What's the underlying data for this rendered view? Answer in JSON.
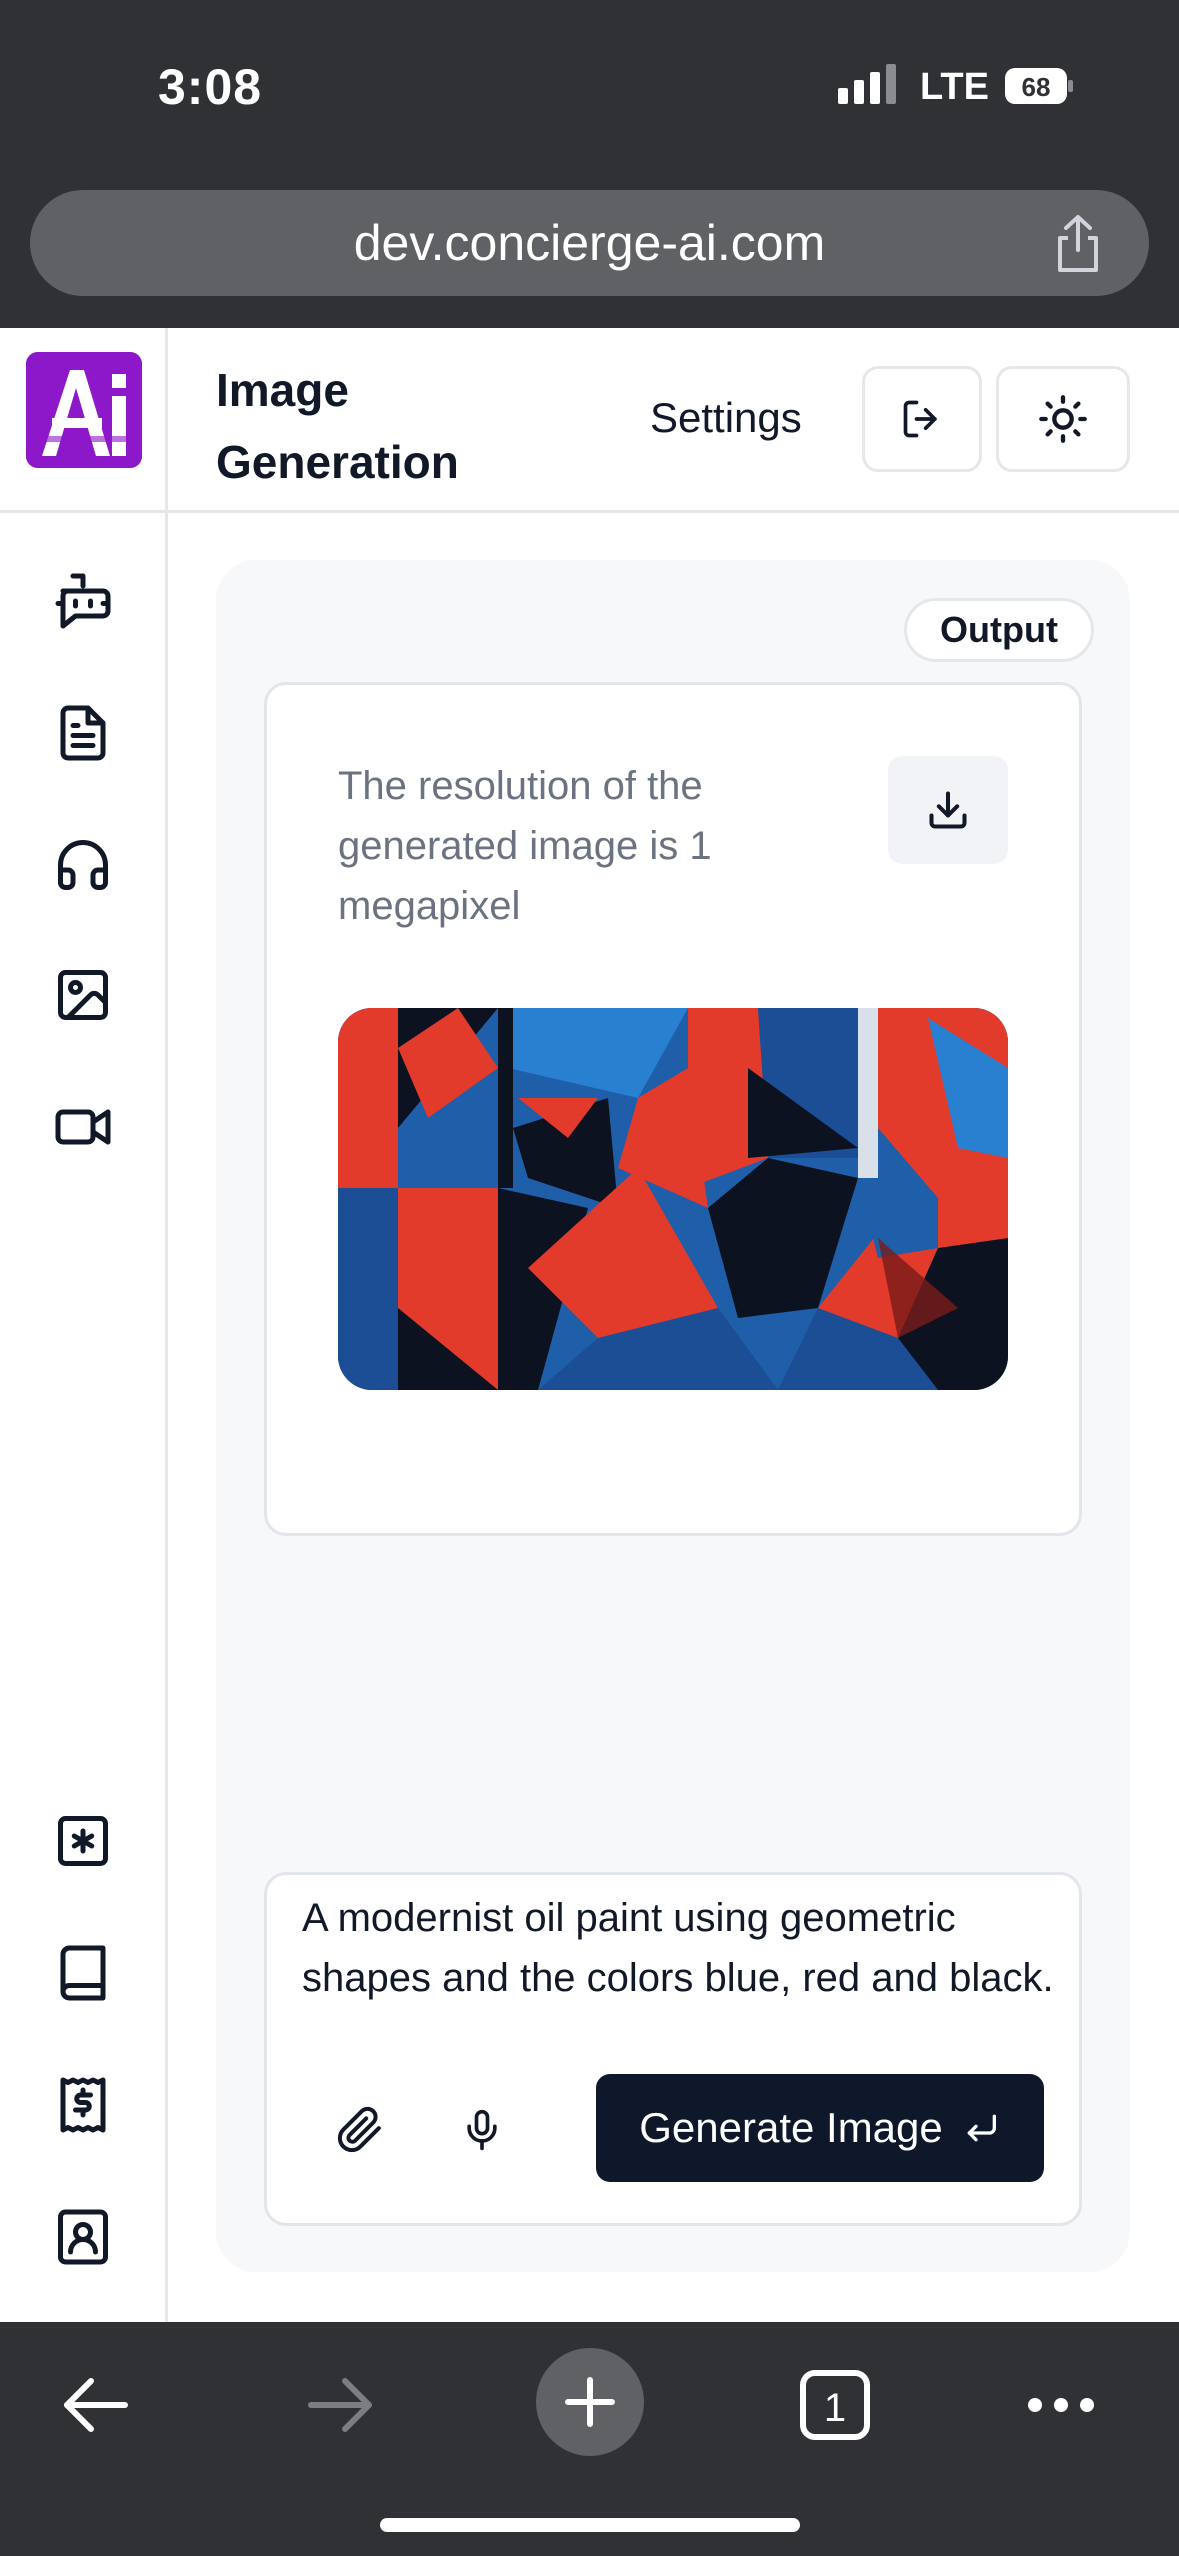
{
  "status_bar": {
    "time": "3:08",
    "network": "LTE",
    "battery": "68"
  },
  "browser": {
    "url": "dev.concierge-ai.com",
    "tab_count": "1"
  },
  "app": {
    "logo_text": "Ai",
    "page_title": "Image Generation",
    "settings_label": "Settings"
  },
  "sidebar": {
    "items": [
      {
        "icon": "bot-icon"
      },
      {
        "icon": "document-icon"
      },
      {
        "icon": "headphones-icon"
      },
      {
        "icon": "image-icon"
      },
      {
        "icon": "video-icon"
      },
      {
        "icon": "asterisk-icon"
      },
      {
        "icon": "book-icon"
      },
      {
        "icon": "receipt-icon"
      },
      {
        "icon": "contact-icon"
      }
    ]
  },
  "output": {
    "badge_label": "Output",
    "resolution_text": "The resolution of the generated image is 1 megapixel"
  },
  "prompt": {
    "text": "A modernist oil paint using geometric shapes and the colors blue, red and black.",
    "generate_label": "Generate Image"
  },
  "colors": {
    "brand_purple": "#8d18c9",
    "button_dark": "#0f172a",
    "chrome": "#2f3134"
  }
}
